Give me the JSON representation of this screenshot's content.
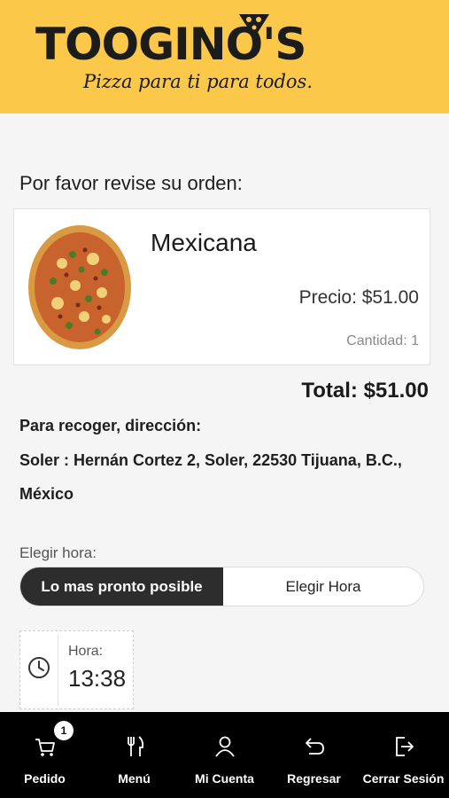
{
  "brand": {
    "name": "TOOGINO'S",
    "tagline": "Pizza para ti para todos.",
    "color": "#fcc84a"
  },
  "review": {
    "title": "Por favor revise su orden:"
  },
  "item": {
    "name": "Mexicana",
    "price": "Precio: $51.00",
    "quantity": "Cantidad: 1",
    "image_icon": "pizza-image"
  },
  "total": "Total: $51.00",
  "pickup": {
    "label": "Para recoger, dirección:",
    "address": "Soler : Hernán Cortez 2, Soler, 22530 Tijuana, B.C., México"
  },
  "time_choice": {
    "label": "Elegir hora:",
    "options": [
      "Lo mas pronto posible",
      "Elegir Hora"
    ],
    "selected": "Lo mas pronto posible"
  },
  "time": {
    "caption": "Hora:",
    "value": "13:38",
    "icon": "clock-icon"
  },
  "tabbar": {
    "items": [
      {
        "label": "Pedido",
        "icon": "cart-icon",
        "badge": "1"
      },
      {
        "label": "Menú",
        "icon": "fork-knife-icon"
      },
      {
        "label": "Mi Cuenta",
        "icon": "user-icon"
      },
      {
        "label": "Regresar",
        "icon": "back-icon"
      },
      {
        "label": "Cerrar Sesión",
        "icon": "logout-icon"
      }
    ]
  }
}
